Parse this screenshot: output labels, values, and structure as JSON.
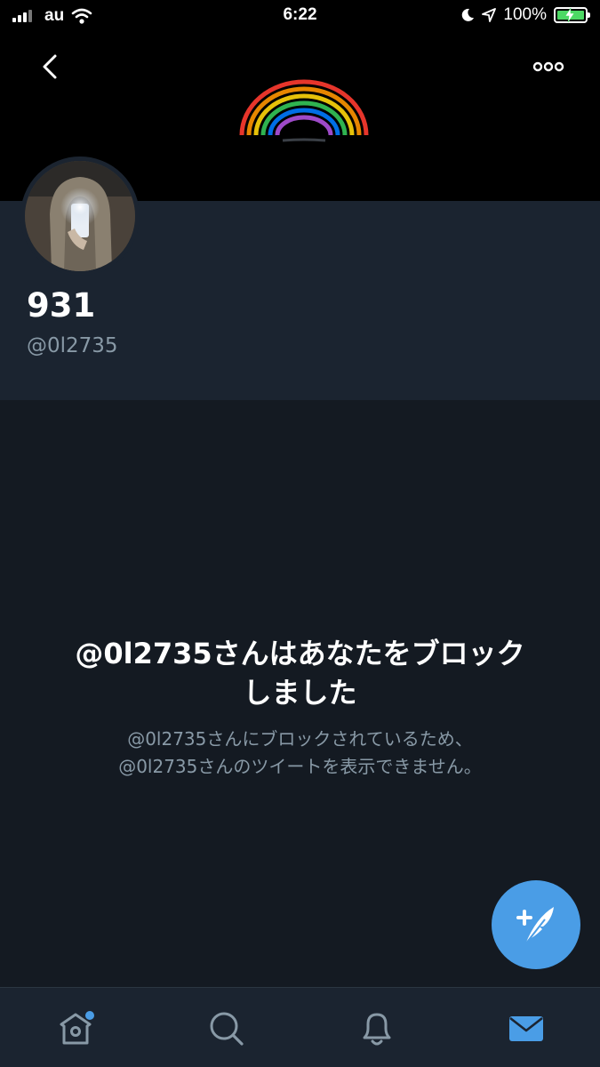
{
  "status_bar": {
    "carrier": "au",
    "time": "6:22",
    "battery": "100%",
    "battery_level": 1.0
  },
  "profile": {
    "display_name": "931",
    "handle": "@0l2735"
  },
  "blocked": {
    "title_line1": "@0l2735さんはあなたをブロック",
    "title_line2": "しました",
    "desc_line1": "@0l2735さんにブロックされているため、",
    "desc_line2": "@0l2735さんのツイートを表示できません。"
  },
  "icons": {
    "back": "chevron-left-icon",
    "more": "more-horizontal-icon",
    "compose": "compose-tweet-icon",
    "home": "home-icon",
    "search": "search-icon",
    "notifications": "bell-icon",
    "messages": "mail-icon"
  },
  "colors": {
    "accent": "#4a9de6",
    "background": "#141a22",
    "header_bg": "#1b2430",
    "secondary_text": "#8899a6"
  },
  "tabs": [
    {
      "name": "home",
      "active": false,
      "has_badge": true
    },
    {
      "name": "search",
      "active": false,
      "has_badge": false
    },
    {
      "name": "notifications",
      "active": false,
      "has_badge": false
    },
    {
      "name": "messages",
      "active": true,
      "has_badge": false
    }
  ]
}
